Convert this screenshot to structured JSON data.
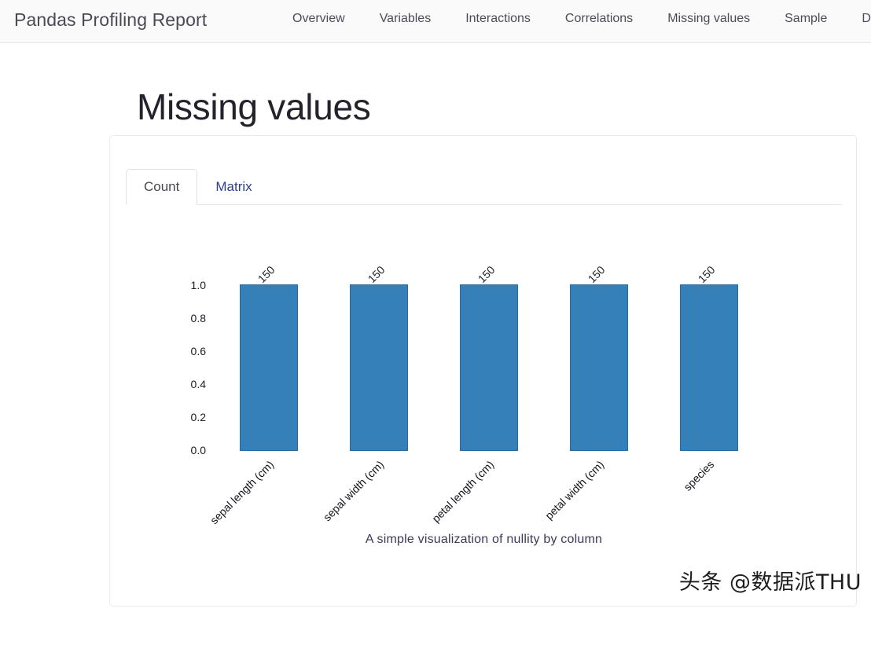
{
  "navbar": {
    "brand": "Pandas Profiling Report",
    "items": [
      {
        "label": "Overview"
      },
      {
        "label": "Variables"
      },
      {
        "label": "Interactions"
      },
      {
        "label": "Correlations"
      },
      {
        "label": "Missing values"
      },
      {
        "label": "Sample"
      },
      {
        "label": "D"
      }
    ]
  },
  "page": {
    "title": "Missing values"
  },
  "card": {
    "tabs": [
      {
        "label": "Count",
        "active": true
      },
      {
        "label": "Matrix",
        "active": false
      }
    ],
    "caption": "A simple visualization of nullity by column"
  },
  "watermark": "头条 @数据派THU",
  "colors": {
    "bar_fill": "#3580b8",
    "bar_edge": "#2a6a9c",
    "tab_link": "#2c3e8f",
    "page_bg": "#ffffff",
    "navbar_bg": "#fafafb"
  },
  "chart_data": {
    "type": "bar",
    "title": "",
    "subtitle": "A simple visualization of nullity by column",
    "xlabel": "",
    "ylabel": "",
    "categories": [
      "sepal length (cm)",
      "sepal width (cm)",
      "petal length (cm)",
      "petal width (cm)",
      "species"
    ],
    "values": [
      1.0,
      1.0,
      1.0,
      1.0,
      1.0
    ],
    "data_labels": [
      "150",
      "150",
      "150",
      "150",
      "150"
    ],
    "counts": [
      150,
      150,
      150,
      150,
      150
    ],
    "ylim": [
      0.0,
      1.0
    ],
    "yticks": [
      "1.0",
      "0.8",
      "0.6",
      "0.4",
      "0.2",
      "0.0"
    ],
    "ytick_values": [
      1.0,
      0.8,
      0.6,
      0.4,
      0.2,
      0.0
    ],
    "grid": false,
    "legend": false,
    "xtick_rotation": -45,
    "data_label_rotation": -45
  }
}
